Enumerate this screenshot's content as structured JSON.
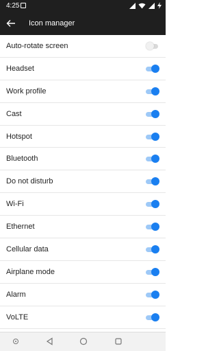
{
  "status_bar": {
    "time": "4:25",
    "icons": [
      "image-notification-icon",
      "signal-icon",
      "wifi-icon",
      "cellular-icon",
      "battery-charging-icon"
    ]
  },
  "app_bar": {
    "title": "Icon manager",
    "back_icon": "arrow-back-icon"
  },
  "settings": [
    {
      "label": "Auto-rotate screen",
      "enabled": false
    },
    {
      "label": "Headset",
      "enabled": true
    },
    {
      "label": "Work profile",
      "enabled": true
    },
    {
      "label": "Cast",
      "enabled": true
    },
    {
      "label": "Hotspot",
      "enabled": true
    },
    {
      "label": "Bluetooth",
      "enabled": true
    },
    {
      "label": "Do not disturb",
      "enabled": true
    },
    {
      "label": "Wi-Fi",
      "enabled": true
    },
    {
      "label": "Ethernet",
      "enabled": true
    },
    {
      "label": "Cellular data",
      "enabled": true
    },
    {
      "label": "Airplane mode",
      "enabled": true
    },
    {
      "label": "Alarm",
      "enabled": true
    },
    {
      "label": "VoLTE",
      "enabled": true
    }
  ],
  "colors": {
    "accent": "#1a7ff0",
    "bar_background": "#1f1f1f"
  },
  "nav_bar": {
    "buttons": [
      "assistant-icon",
      "back-icon",
      "home-icon",
      "recents-icon"
    ]
  }
}
